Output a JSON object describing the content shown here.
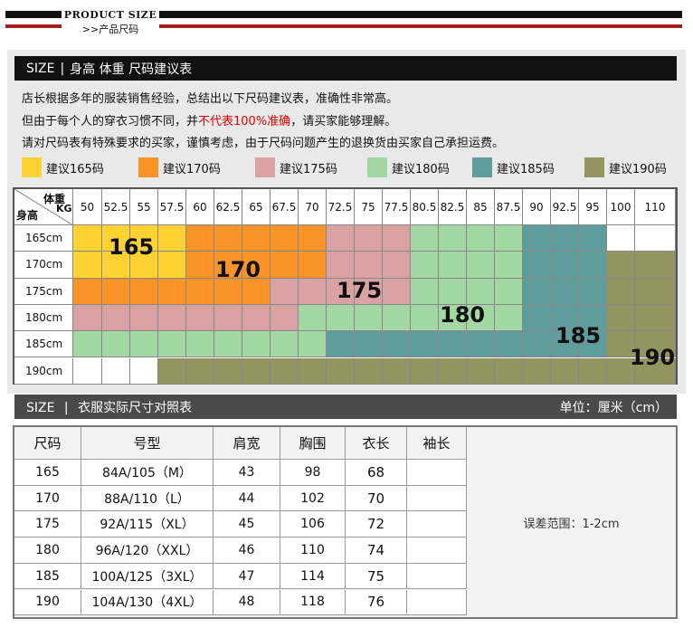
{
  "header": {
    "title_en": "PRODUCT SIZE",
    "title_cn": ">>产品尺码"
  },
  "section1": {
    "prefix": "SIZE",
    "title": "身高 体重 尺码建议表",
    "notes": [
      "店长根据多年的服装销售经验，总结出以下尺码建议表，准确性非常高。",
      "但由于每个人的穿衣习惯不同，并",
      "不代表100%准确",
      "，请买家能够理解。",
      "请对尺码表有特殊要求的买家，谨慎考虑，由于尺码问题产生的退换货由买家自己承担运费。"
    ]
  },
  "legend": [
    {
      "label": "建议165码",
      "color": "#fdd232"
    },
    {
      "label": "建议170码",
      "color": "#fa9428"
    },
    {
      "label": "建议175码",
      "color": "#d9a3a3"
    },
    {
      "label": "建议180码",
      "color": "#a3d7a3"
    },
    {
      "label": "建议185码",
      "color": "#5f9c9c"
    },
    {
      "label": "建议190码",
      "color": "#949460"
    }
  ],
  "grid": {
    "weight_label": "体重",
    "kg_label": "KG",
    "height_label": "身高",
    "weights": [
      "50",
      "52.5",
      "55",
      "57.5",
      "60",
      "62.5",
      "65",
      "67.5",
      "70",
      "72.5",
      "75",
      "77.5",
      "80.5",
      "82.5",
      "85",
      "87.5",
      "90",
      "92.5",
      "95",
      "100",
      "110"
    ],
    "heights": [
      "165cm",
      "170cm",
      "175cm",
      "180cm",
      "185cm",
      "190cm"
    ],
    "cells": [
      [
        1,
        1,
        1,
        1,
        2,
        2,
        2,
        2,
        2,
        3,
        3,
        3,
        4,
        4,
        4,
        4,
        5,
        5,
        5,
        0,
        0
      ],
      [
        1,
        1,
        1,
        1,
        2,
        2,
        2,
        2,
        2,
        3,
        3,
        3,
        4,
        4,
        4,
        4,
        5,
        5,
        5,
        6,
        6
      ],
      [
        2,
        2,
        2,
        2,
        2,
        2,
        2,
        3,
        3,
        3,
        3,
        3,
        4,
        4,
        4,
        4,
        5,
        5,
        5,
        6,
        6
      ],
      [
        3,
        3,
        3,
        3,
        3,
        3,
        3,
        3,
        4,
        4,
        4,
        4,
        4,
        4,
        4,
        4,
        5,
        5,
        5,
        6,
        6
      ],
      [
        4,
        4,
        4,
        4,
        4,
        4,
        4,
        4,
        4,
        5,
        5,
        5,
        5,
        5,
        5,
        5,
        5,
        5,
        5,
        6,
        6
      ],
      [
        0,
        0,
        0,
        6,
        6,
        6,
        6,
        6,
        6,
        6,
        6,
        6,
        6,
        6,
        6,
        6,
        6,
        6,
        6,
        6,
        6
      ]
    ],
    "zone_labels": [
      "165",
      "170",
      "175",
      "180",
      "185",
      "190"
    ]
  },
  "section2": {
    "prefix": "SIZE",
    "title": "衣服实际尺寸对照表",
    "unit": "单位：厘米（cm）"
  },
  "measure": {
    "headers": [
      "尺码",
      "号型",
      "肩宽",
      "胸围",
      "衣长",
      "袖长"
    ],
    "rows": [
      [
        "165",
        "84A/105（M）",
        "43",
        "98",
        "68",
        ""
      ],
      [
        "170",
        "88A/110（L）",
        "44",
        "102",
        "70",
        ""
      ],
      [
        "175",
        "92A/115（XL）",
        "45",
        "106",
        "72",
        ""
      ],
      [
        "180",
        "96A/120（XXL）",
        "46",
        "110",
        "74",
        ""
      ],
      [
        "185",
        "100A/125（3XL）",
        "47",
        "114",
        "75",
        ""
      ],
      [
        "190",
        "104A/130（4XL）",
        "48",
        "118",
        "76",
        ""
      ]
    ],
    "error_note": "误差范围：1-2cm"
  }
}
